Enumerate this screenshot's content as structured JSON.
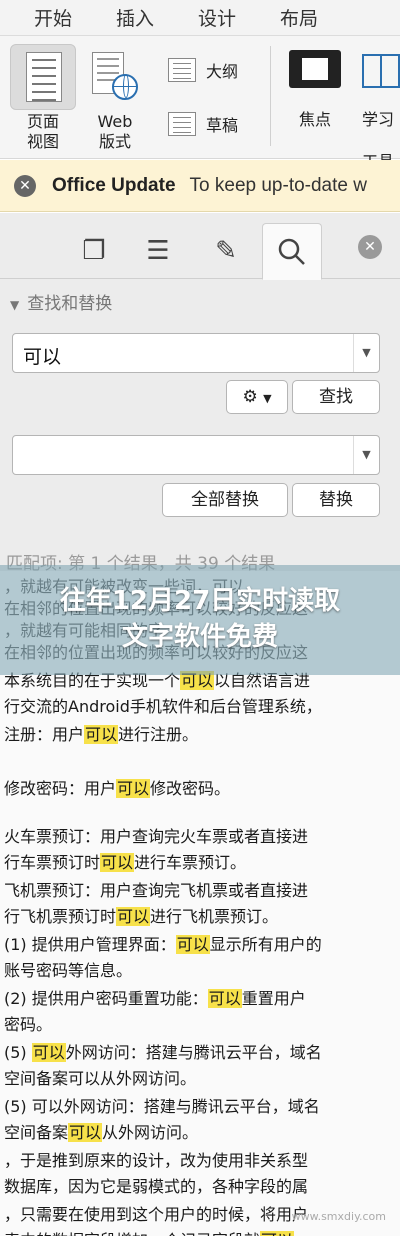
{
  "menu": {
    "items": [
      "开始",
      "插入",
      "设计",
      "布局"
    ]
  },
  "ribbon": {
    "page_view_label_1": "页面",
    "page_view_label_2": "视图",
    "web_label_1": "Web",
    "web_label_2": "版式",
    "outline_label": "大纲",
    "draft_label": "草稿",
    "focus_label": "焦点",
    "learn_label_1": "学习",
    "learn_label_2": "工具"
  },
  "update_bar": {
    "title": "Office Update",
    "message": "To keep up-to-date w"
  },
  "find_panel": {
    "section_title": "查找和替换",
    "search_value": "可以",
    "replace_value": "",
    "find_button": "查找",
    "replace_all_button": "全部替换",
    "replace_button": "替换",
    "match_header": "匹配项: 第 1 个结果，共 39 个结果"
  },
  "results": [
    {
      "pre": "，就越有可能被改变一些词，可以",
      "hl": "",
      "post": "",
      "faded": true
    },
    {
      "pre": "在相邻的位置出现的频率可以较好的反应这",
      "hl": "",
      "post": "",
      "faded": true
    },
    {
      "pre": "，就越有可能",
      "hl": "",
      "post": "相同的字",
      "faded": true
    },
    {
      "pre": "在相邻的位置出现的频率可以较好的反应这",
      "hl": "",
      "post": "",
      "faded": true
    },
    {
      "pre": "本系统目的在于实现一个",
      "hl": "可以",
      "post": "以自然语言进",
      "faded": false
    },
    {
      "pre": "行交流的Android手机软件和后台管理系统，",
      "hl": "",
      "post": "",
      "faded": false
    },
    {
      "pre": "注册：用户",
      "hl": "可以",
      "post": "进行注册。",
      "faded": false
    },
    {
      "pre": "修改密码：用户",
      "hl": "可以",
      "post": "修改密码。",
      "faded": false
    },
    {
      "pre": "火车票预订：用户查询完火车票或者直接进",
      "hl": "",
      "post": "",
      "faded": false
    },
    {
      "pre": "行车票预订时",
      "hl": "可以",
      "post": "进行车票预订。",
      "faded": false
    },
    {
      "pre": "飞机票预订：用户查询完飞机票或者直接进",
      "hl": "",
      "post": "",
      "faded": false
    },
    {
      "pre": "行飞机票预订时",
      "hl": "可以",
      "post": "进行飞机票预订。",
      "faded": false
    },
    {
      "pre": "(1) 提供用户管理界面：",
      "hl": "可以",
      "post": "显示所有用户的",
      "faded": false
    },
    {
      "pre": "账号密码等信息。",
      "hl": "",
      "post": "",
      "faded": false
    },
    {
      "pre": "(2) 提供用户密码重置功能：",
      "hl": "可以",
      "post": "重置用户",
      "faded": false
    },
    {
      "pre": "密码。",
      "hl": "",
      "post": "",
      "faded": false
    },
    {
      "pre": "(5) ",
      "hl": "可以",
      "post": "外网访问：搭建与腾讯云平台，域名",
      "faded": false
    },
    {
      "pre": "空间备案可以从外网访问。",
      "hl": "",
      "post": "",
      "faded": false
    },
    {
      "pre": "(5) 可以外网访问：搭建与腾讯云平台，域名",
      "hl": "",
      "post": "",
      "faded": false
    },
    {
      "pre": "空间备案",
      "hl": "可以",
      "post": "从外网访问。",
      "faded": false
    },
    {
      "pre": "，于是推到原来的设计，改为使用非关系型",
      "hl": "",
      "post": "",
      "faded": false
    },
    {
      "pre": "数据库，因为它是弱模式的，各种字段的属",
      "hl": "",
      "post": "",
      "faded": false
    },
    {
      "pre": "，只需要在使用到这个用户的时候，将用户",
      "hl": "",
      "post": "",
      "faded": false
    },
    {
      "pre": "表中的数据字段增加一个记录字段就",
      "hl": "可以",
      "post": "",
      "faded": false
    }
  ],
  "banner": {
    "line1": "往年12月27日实时读取",
    "line2": "文字软件免费"
  },
  "watermark": "www.smxdiy.com",
  "colors": {
    "highlight": "#f7e14a",
    "update_bar": "#fdf3d4",
    "panel": "#ececec"
  }
}
